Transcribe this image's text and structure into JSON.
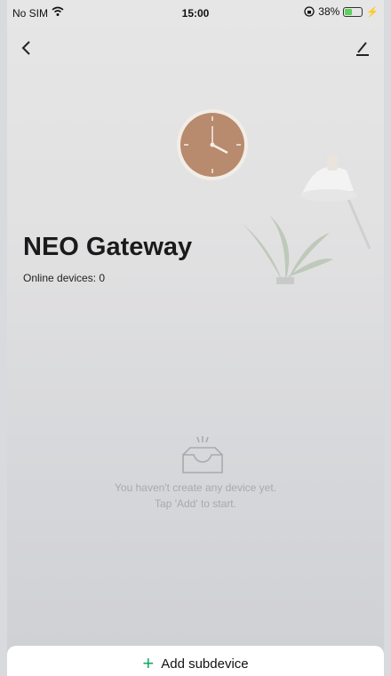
{
  "status_bar": {
    "carrier": "No SIM",
    "time": "15:00",
    "battery_percent": "38%",
    "battery_level": 0.38
  },
  "nav": {
    "back_icon": "chevron-left-icon",
    "edit_icon": "pencil-icon"
  },
  "gateway": {
    "name": "NEO Gateway",
    "online_devices": "Online devices: 0"
  },
  "empty_state": {
    "icon": "empty-tray-icon",
    "line1": "You haven't create any device yet.",
    "line2": "Tap 'Add' to start."
  },
  "bottom_bar": {
    "plus_icon": "+",
    "add_label": "Add subdevice",
    "accent_color": "#1aa96a"
  }
}
